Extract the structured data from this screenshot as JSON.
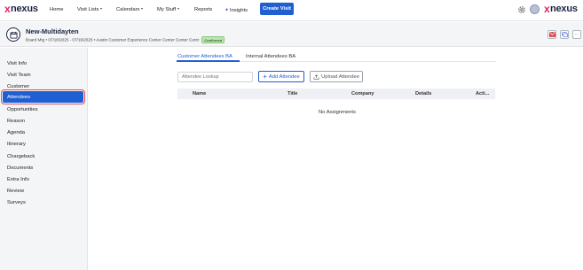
{
  "brand": {
    "name": "nexus",
    "mark": "x"
  },
  "nav": {
    "items": [
      {
        "label": "Home"
      },
      {
        "label": "Visit Lists"
      },
      {
        "label": "Calendars"
      },
      {
        "label": "My Stuff"
      },
      {
        "label": "Reports"
      },
      {
        "label": "Insights"
      }
    ],
    "create_label": "Create Visit"
  },
  "header": {
    "title": "New-Multidayten",
    "subtitle": "Board Mtg • 07/18/2025 - 07/19/2025 • Austin Customer Experience Center Center Center Centr",
    "status": "Confirmed",
    "more_label": "···"
  },
  "sidebar": {
    "items": [
      {
        "label": "Visit Info"
      },
      {
        "label": "Visit Team"
      },
      {
        "label": "Customer"
      },
      {
        "label": "Attendees",
        "active": true
      },
      {
        "label": "Opportunities"
      },
      {
        "label": "Reason"
      },
      {
        "label": "Agenda"
      },
      {
        "label": "Itinerary"
      },
      {
        "label": "Chargeback"
      },
      {
        "label": "Documents"
      },
      {
        "label": "Extra Info"
      },
      {
        "label": "Review"
      },
      {
        "label": "Surveys"
      }
    ]
  },
  "main": {
    "tabs": [
      {
        "label": "Customer Attendees BA",
        "active": true
      },
      {
        "label": "Internal Attendees BA"
      }
    ],
    "lookup_placeholder": "Attendee Lookup",
    "add_label": "Add Attendee",
    "upload_label": "Upload Attendee",
    "columns": [
      "Name",
      "Title",
      "Company",
      "Details",
      "Acti..."
    ],
    "empty_message": "No Assignments"
  },
  "colors": {
    "accent": "#1f5fd1",
    "brand_x": "#e0245e",
    "status_bg": "#bfe3b4"
  }
}
